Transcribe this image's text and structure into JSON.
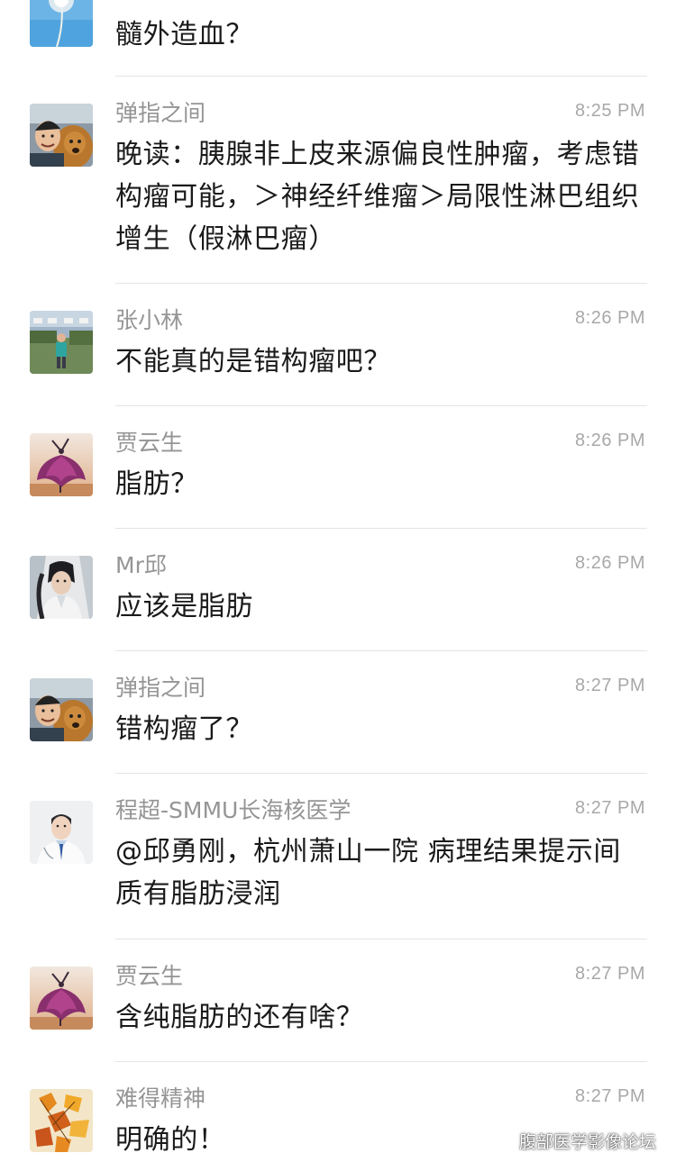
{
  "messages": [
    {
      "sender": "",
      "time": "",
      "text": "髓外造血？",
      "avatar_icon": "dandelion-avatar-icon"
    },
    {
      "sender": "弹指之间",
      "time": "8:25 PM",
      "text": "晚读：胰腺非上皮来源偏良性肿瘤，考虑错构瘤可能，＞神经纤维瘤＞局限性淋巴组织增生（假淋巴瘤）",
      "avatar_icon": "man-with-dog-avatar-icon"
    },
    {
      "sender": "张小林",
      "time": "8:26 PM",
      "text": "不能真的是错构瘤吧？",
      "avatar_icon": "person-outdoors-avatar-icon"
    },
    {
      "sender": "贾云生",
      "time": "8:26 PM",
      "text": "脂肪？",
      "avatar_icon": "dancer-avatar-icon"
    },
    {
      "sender": "Mr邱",
      "time": "8:26 PM",
      "text": "应该是脂肪",
      "avatar_icon": "costume-portrait-avatar-icon"
    },
    {
      "sender": "弹指之间",
      "time": "8:27 PM",
      "text": "错构瘤了？",
      "avatar_icon": "man-with-dog-avatar-icon"
    },
    {
      "sender": "程超-SMMU长海核医学",
      "time": "8:27 PM",
      "text": "@邱勇刚，杭州萧山一院 病理结果提示间质有脂肪浸润",
      "avatar_icon": "doctor-avatar-icon"
    },
    {
      "sender": "贾云生",
      "time": "8:27 PM",
      "text": "含纯脂肪的还有啥？",
      "avatar_icon": "dancer-avatar-icon"
    },
    {
      "sender": "难得精神",
      "time": "8:27 PM",
      "text": "明确的！",
      "avatar_icon": "autumn-leaves-avatar-icon"
    }
  ],
  "watermark": {
    "text": "腹部医学影像论坛",
    "icon": "wechat-icon"
  },
  "colors": {
    "sender": "#959595",
    "time": "#a8a8a8",
    "text": "#1a1a1a",
    "divider": "#e4e4e4",
    "background": "#ffffff"
  }
}
